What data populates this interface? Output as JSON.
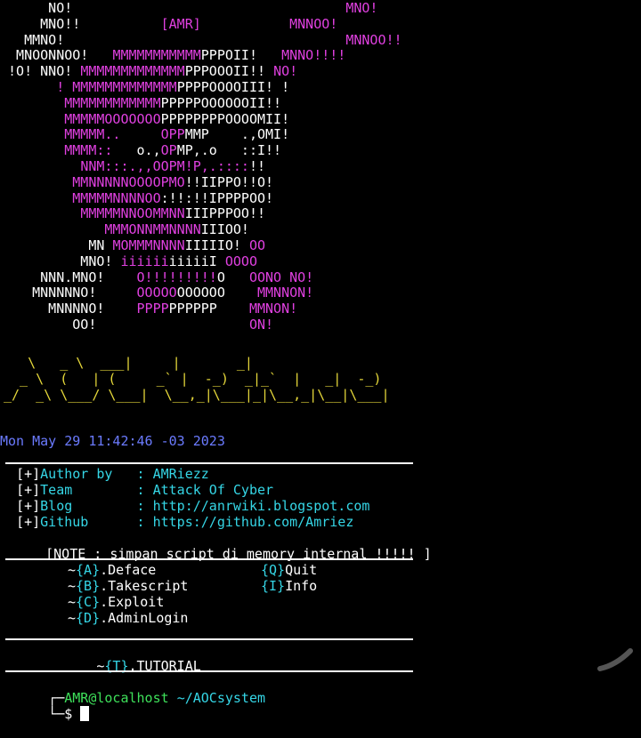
{
  "art": [
    [
      {
        "t": "      NO!                                  ",
        "c": "w"
      },
      {
        "t": "MNO!",
        "c": "m"
      }
    ],
    [
      {
        "t": "     MNO!!          ",
        "c": "w"
      },
      {
        "t": "[AMR]",
        "c": "m"
      },
      {
        "t": "           ",
        "c": "w"
      },
      {
        "t": "MNNOO!",
        "c": "m"
      }
    ],
    [
      {
        "t": "   MMNO!                                   ",
        "c": "w"
      },
      {
        "t": "MNNOO!!",
        "c": "m"
      }
    ],
    [
      {
        "t": "  MNOONNOO!   ",
        "c": "w"
      },
      {
        "t": "MMMMMMMMMMM",
        "c": "m"
      },
      {
        "t": "PPPOII!   ",
        "c": "w"
      },
      {
        "t": "MNNO!!!!",
        "c": "m"
      }
    ],
    [
      {
        "t": " !O! NNO! ",
        "c": "w"
      },
      {
        "t": "MMMMMMMMMMMMM",
        "c": "m"
      },
      {
        "t": "PPPOOOII!! ",
        "c": "w"
      },
      {
        "t": "NO!",
        "c": "m"
      }
    ],
    [
      {
        "t": "       ",
        "c": "w"
      },
      {
        "t": "! MMMMMMMMMMMMM",
        "c": "m"
      },
      {
        "t": "PPPPOOOOIII! !",
        "c": "w"
      }
    ],
    [
      {
        "t": "        ",
        "c": "w"
      },
      {
        "t": "MMMMMMMMMMMM",
        "c": "m"
      },
      {
        "t": "PPPPPOOOOOOII!!",
        "c": "w"
      }
    ],
    [
      {
        "t": "        ",
        "c": "w"
      },
      {
        "t": "MMMMMOOOOOOO",
        "c": "m"
      },
      {
        "t": "PPPPPPPPOOOOMII!",
        "c": "w"
      }
    ],
    [
      {
        "t": "        ",
        "c": "w"
      },
      {
        "t": "MMMMM..     OPP",
        "c": "m"
      },
      {
        "t": "MMP    .,OMI!",
        "c": "w"
      }
    ],
    [
      {
        "t": "        ",
        "c": "w"
      },
      {
        "t": "MMMM::",
        "c": "m"
      },
      {
        "t": "   o.,",
        "c": "w"
      },
      {
        "t": "OP",
        "c": "m"
      },
      {
        "t": "MP,.o   ::I!!",
        "c": "w"
      }
    ],
    [
      {
        "t": "          ",
        "c": "w"
      },
      {
        "t": "NNM:::.,,OOPM!P,.::::",
        "c": "m"
      },
      {
        "t": "!!",
        "c": "w"
      }
    ],
    [
      {
        "t": "         ",
        "c": "w"
      },
      {
        "t": "MMNNNNNOOOOPMO",
        "c": "m"
      },
      {
        "t": "!!IIPPO!!O!",
        "c": "w"
      }
    ],
    [
      {
        "t": "         ",
        "c": "w"
      },
      {
        "t": "MMMMMNNNNOO",
        "c": "m"
      },
      {
        "t": ":!!:!!IPPPPOO!",
        "c": "w"
      }
    ],
    [
      {
        "t": "          ",
        "c": "w"
      },
      {
        "t": "MMMMMNNOOMMNN",
        "c": "m"
      },
      {
        "t": "IIIPPPOO!!",
        "c": "w"
      }
    ],
    [
      {
        "t": "             ",
        "c": "w"
      },
      {
        "t": "MMMONNMMNNNN",
        "c": "m"
      },
      {
        "t": "IIIOO!",
        "c": "w"
      }
    ],
    [
      {
        "t": "           MN ",
        "c": "w"
      },
      {
        "t": "MOMMMNNNN",
        "c": "m"
      },
      {
        "t": "IIIIIO! ",
        "c": "w"
      },
      {
        "t": "OO",
        "c": "m"
      }
    ],
    [
      {
        "t": "          MNO! ",
        "c": "w"
      },
      {
        "t": "iiiiii",
        "c": "m"
      },
      {
        "t": "iiiiiI ",
        "c": "w"
      },
      {
        "t": "OOOO",
        "c": "m"
      }
    ],
    [
      {
        "t": "     NNN.MNO!    ",
        "c": "w"
      },
      {
        "t": "O!!!!!!!!!",
        "c": "m"
      },
      {
        "t": "O   ",
        "c": "w"
      },
      {
        "t": "OONO NO!",
        "c": "m"
      }
    ],
    [
      {
        "t": "    MNNNNNO!     ",
        "c": "w"
      },
      {
        "t": "OOOOO",
        "c": "m"
      },
      {
        "t": "OOOOOO    ",
        "c": "w"
      },
      {
        "t": "MMNNON!",
        "c": "m"
      }
    ],
    [
      {
        "t": "      MNNNNO!    ",
        "c": "w"
      },
      {
        "t": "PPPP",
        "c": "m"
      },
      {
        "t": "PPPPPP    ",
        "c": "w"
      },
      {
        "t": "MMNON!",
        "c": "m"
      }
    ],
    [
      {
        "t": "         OO!                   ",
        "c": "w"
      },
      {
        "t": "ON!",
        "c": "m"
      }
    ]
  ],
  "banner": [
    "   \\   _ \\  ___|     |       _|",
    "  _ \\  (   | (     _` |  -_)  _|_`  |   _|  -_)",
    "_/  _\\ \\___/ \\___|  \\__,_|\\___|_|\\__,_|\\__|\\___|"
  ],
  "date": "Mon May 29 11:42:46 -03 2023",
  "info": [
    {
      "tag": "[+]",
      "key": "Author by   ",
      "sep": ": ",
      "val": "AMRiezz"
    },
    {
      "tag": "[+]",
      "key": "Team        ",
      "sep": ": ",
      "val": "Attack Of Cyber"
    },
    {
      "tag": "[+]",
      "key": "Blog        ",
      "sep": ": ",
      "val": "http://anrwiki.blogspot.com"
    },
    {
      "tag": "[+]",
      "key": "Github      ",
      "sep": ": ",
      "val": "https://github.com/Amriez"
    }
  ],
  "note": "[NOTE : simpan script di memory internal !!!!! ]",
  "menu": [
    {
      "left": {
        "key": "A",
        "label": ".Deface"
      },
      "right": {
        "key": "Q",
        "label": "Quit"
      }
    },
    {
      "left": {
        "key": "B",
        "label": ".Takescript"
      },
      "right": {
        "key": "I",
        "label": "Info"
      }
    },
    {
      "left": {
        "key": "C",
        "label": ".Exploit"
      },
      "right": null
    },
    {
      "left": {
        "key": "D",
        "label": ".AdminLogin"
      },
      "right": null
    }
  ],
  "tutorial": {
    "key": "T",
    "label": ".TUTORIAL"
  },
  "prompt": {
    "user": "AMR@localhost",
    "path": "~/AOCsystem",
    "symbol": "$"
  },
  "colors": {
    "magenta": "#e040e0",
    "yellow": "#e6d83a",
    "cyan": "#35d6e6",
    "green": "#3ee05a",
    "blue": "#6b7bff"
  }
}
